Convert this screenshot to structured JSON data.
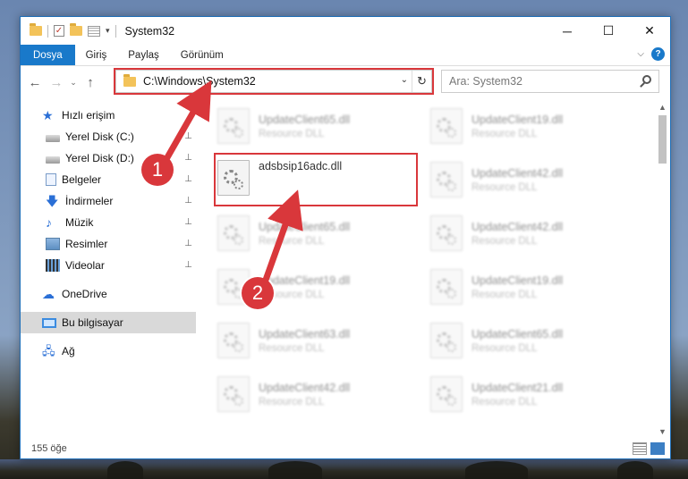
{
  "window": {
    "title": "System32",
    "controls": {
      "minimize": "─",
      "maximize": "☐",
      "close": "✕"
    }
  },
  "ribbon": {
    "tabs": [
      "Dosya",
      "Giriş",
      "Paylaş",
      "Görünüm"
    ],
    "help": "?",
    "chevron": "⌵"
  },
  "nav": {
    "back": "←",
    "forward": "→",
    "recent": "⌄",
    "up": "↑",
    "address": "C:\\Windows\\System32",
    "address_dropdown": "⌄",
    "refresh": "↻",
    "search_placeholder": "Ara: System32"
  },
  "sidebar": {
    "items": [
      {
        "label": "Hızlı erişim",
        "icon": "star-icon",
        "pinned": false,
        "selected": false
      },
      {
        "label": "Yerel Disk (C:)",
        "icon": "disk-icon",
        "pinned": true,
        "selected": false
      },
      {
        "label": "Yerel Disk (D:)",
        "icon": "disk-icon",
        "pinned": true,
        "selected": false
      },
      {
        "label": "Belgeler",
        "icon": "document-icon",
        "pinned": true,
        "selected": false
      },
      {
        "label": "İndirmeler",
        "icon": "download-icon",
        "pinned": true,
        "selected": false
      },
      {
        "label": "Müzik",
        "icon": "music-icon",
        "pinned": true,
        "selected": false
      },
      {
        "label": "Resimler",
        "icon": "pictures-icon",
        "pinned": true,
        "selected": false
      },
      {
        "label": "Videolar",
        "icon": "video-icon",
        "pinned": true,
        "selected": false
      },
      {
        "label": "OneDrive",
        "icon": "cloud-icon",
        "pinned": false,
        "selected": false
      },
      {
        "label": "Bu bilgisayar",
        "icon": "computer-icon",
        "pinned": false,
        "selected": true
      },
      {
        "label": "Ağ",
        "icon": "network-icon",
        "pinned": false,
        "selected": false
      }
    ],
    "pin_glyph": "📌"
  },
  "files": [
    {
      "name": "UpdateClient65.dll",
      "desc": "Resource DLL",
      "blurred": true
    },
    {
      "name": "UpdateClient19.dll",
      "desc": "Resource DLL",
      "blurred": true
    },
    {
      "name": "adsbsip16adc.dll",
      "desc": "",
      "blurred": false
    },
    {
      "name": "UpdateClient42.dll",
      "desc": "Resource DLL",
      "blurred": true
    },
    {
      "name": "UpdateClient65.dll",
      "desc": "Resource DLL",
      "blurred": true
    },
    {
      "name": "UpdateClient42.dll",
      "desc": "Resource DLL",
      "blurred": true
    },
    {
      "name": "UpdateClient19.dll",
      "desc": "Resource DLL",
      "blurred": true
    },
    {
      "name": "UpdateClient19.dll",
      "desc": "Resource DLL",
      "blurred": true
    },
    {
      "name": "UpdateClient63.dll",
      "desc": "Resource DLL",
      "blurred": true
    },
    {
      "name": "UpdateClient65.dll",
      "desc": "Resource DLL",
      "blurred": true
    },
    {
      "name": "UpdateClient42.dll",
      "desc": "Resource DLL",
      "blurred": true
    },
    {
      "name": "UpdateClient21.dll",
      "desc": "Resource DLL",
      "blurred": true
    }
  ],
  "annotations": {
    "step1": "1",
    "step2": "2",
    "color": "#d9373b"
  },
  "status": {
    "count": "155 öğe"
  },
  "colors": {
    "accent": "#1979ca",
    "highlight": "#d9373b"
  }
}
